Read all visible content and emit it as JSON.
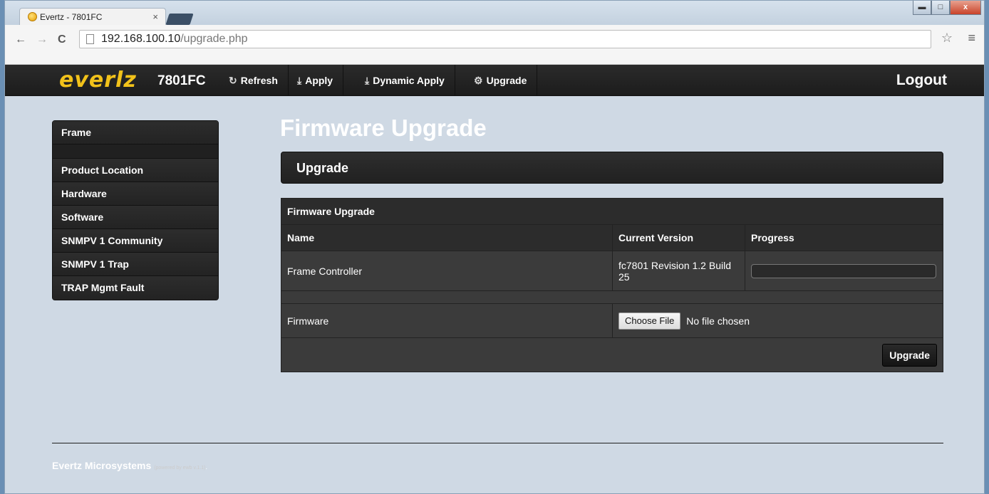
{
  "browser": {
    "tab_title": "Evertz - 7801FC",
    "tab_close": "×",
    "url_host": "192.168.100.10",
    "url_path": "/upgrade.php",
    "window_minimize": "▬",
    "window_maximize": "□",
    "window_close": "x"
  },
  "nav": {
    "logo": "everlz",
    "model": "7801FC",
    "refresh": "Refresh",
    "apply": "Apply",
    "dynamic_apply": "Dynamic Apply",
    "upgrade": "Upgrade",
    "logout": "Logout"
  },
  "sidebar": {
    "items": [
      {
        "label": "Frame"
      },
      {
        "label": "Product Location"
      },
      {
        "label": "Hardware"
      },
      {
        "label": "Software"
      },
      {
        "label": "SNMPV 1 Community"
      },
      {
        "label": "SNMPV 1 Trap"
      },
      {
        "label": "TRAP Mgmt Fault"
      }
    ]
  },
  "main": {
    "page_title": "Firmware Upgrade",
    "section_title": "Upgrade",
    "table_caption": "Firmware Upgrade",
    "columns": [
      "Name",
      "Current Version",
      "Progress"
    ],
    "row": {
      "name": "Frame Controller",
      "version": "fc7801 Revision 1.2 Build 25",
      "progress": 0
    },
    "firmware_label": "Firmware",
    "choose_file": "Choose File",
    "no_file": "No file chosen",
    "upgrade_button": "Upgrade"
  },
  "footer": {
    "company": "Evertz Microsystems",
    "powered": "(powered by ewb v.1.1)",
    "period": "."
  },
  "colors": {
    "brand_yellow": "#f2c21a",
    "background": "#3a3a3a"
  }
}
